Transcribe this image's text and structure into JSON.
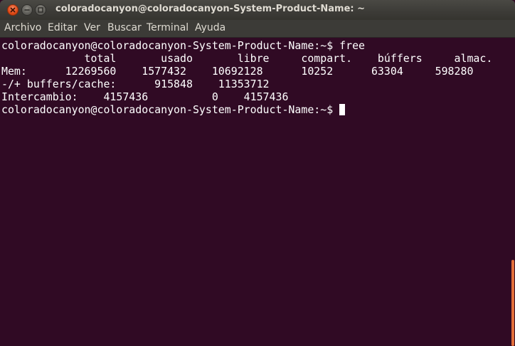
{
  "window": {
    "title": "coloradocanyon@coloradocanyon-System-Product-Name: ~"
  },
  "menu": {
    "items": [
      {
        "label": "Archivo"
      },
      {
        "label": "Editar"
      },
      {
        "label": "Ver"
      },
      {
        "label": "Buscar"
      },
      {
        "label": "Terminal"
      },
      {
        "label": "Ayuda"
      }
    ]
  },
  "terminal": {
    "lines": [
      "coloradocanyon@coloradocanyon-System-Product-Name:~$ free",
      "             total       usado       libre     compart.    búffers     almac.",
      "Mem:      12269560    1577432    10692128      10252      63304     598280",
      "-/+ buffers/cache:      915848    11353712",
      "Intercambio:    4157436          0    4157436"
    ],
    "prompt": "coloradocanyon@coloradocanyon-System-Product-Name:~$"
  },
  "scrollbar": {
    "thumb_start_fraction": 0.72,
    "thumb_end_fraction": 1.0
  },
  "colors": {
    "terminal_background": "#300a24",
    "close_button": "#df4a16",
    "scroll_thumb": "#e36f3b"
  },
  "icons": [
    "close-icon",
    "minimize-icon",
    "maximize-icon"
  ]
}
